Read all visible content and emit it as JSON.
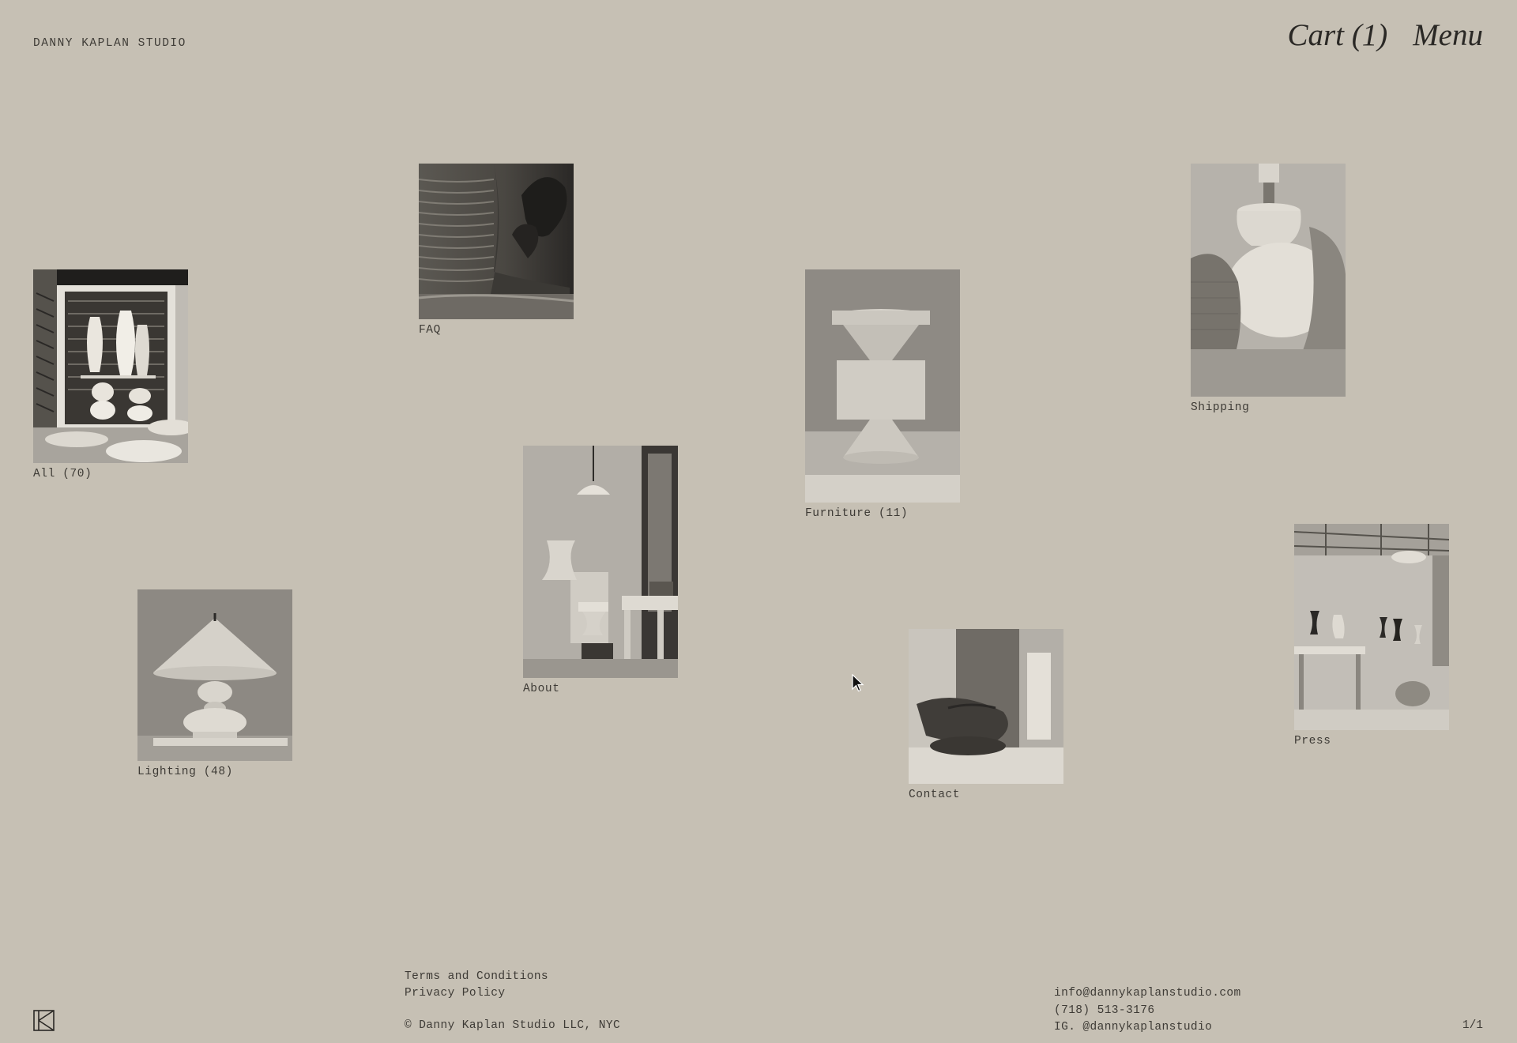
{
  "header": {
    "brand": "DANNY KAPLAN STUDIO",
    "cart_label": "Cart (1)",
    "menu_label": "Menu"
  },
  "tiles": {
    "all": {
      "label": "All (70)",
      "image": "kiln-shelves-vessels"
    },
    "faq": {
      "label": "FAQ",
      "image": "throwing-wheel-closeup"
    },
    "lighting": {
      "label": "Lighting (48)",
      "image": "ceramic-table-lamp"
    },
    "about": {
      "label": "About",
      "image": "studio-interior-pendant"
    },
    "furniture": {
      "label": "Furniture (11)",
      "image": "ceramic-side-table"
    },
    "contact": {
      "label": "Contact",
      "image": "hands-shaping-clay"
    },
    "shipping": {
      "label": "Shipping",
      "image": "lamp-base-with-cloth"
    },
    "press": {
      "label": "Press",
      "image": "studio-workshop-wide"
    }
  },
  "footer": {
    "terms": "Terms and Conditions",
    "privacy": "Privacy Policy",
    "copyright": "© Danny Kaplan Studio LLC, NYC",
    "email": "info@dannykaplanstudio.com",
    "phone": "(718) 513-3176",
    "instagram": "IG. @dannykaplanstudio",
    "pager": "1/1"
  },
  "icons": {
    "logo": "dk-monogram-icon",
    "cursor": "mouse-pointer-icon"
  }
}
